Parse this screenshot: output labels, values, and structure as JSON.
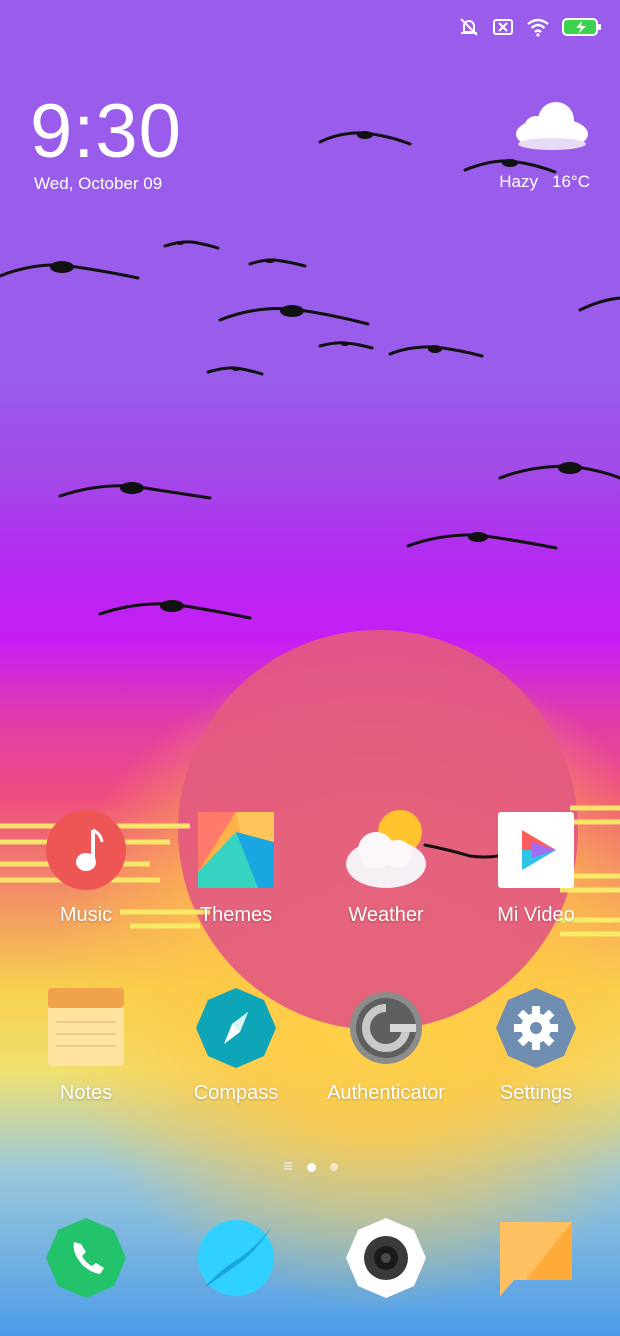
{
  "status_bar": {
    "icons": [
      "silent-off-icon",
      "sim-none-icon",
      "wifi-icon",
      "battery-charging-icon"
    ],
    "battery_color": "#3cd14f"
  },
  "lockscreen_widget": {
    "time": "9:30",
    "date": "Wed, October 09",
    "weather": {
      "condition": "Hazy",
      "temperature": "16°C"
    }
  },
  "apps_row1": [
    {
      "label": "Music",
      "icon": "music-note-icon"
    },
    {
      "label": "Themes",
      "icon": "themes-icon"
    },
    {
      "label": "Weather",
      "icon": "weather-icon"
    },
    {
      "label": "Mi Video",
      "icon": "play-icon"
    }
  ],
  "apps_row2": [
    {
      "label": "Notes",
      "icon": "notes-icon"
    },
    {
      "label": "Compass",
      "icon": "compass-icon"
    },
    {
      "label": "Authenticator",
      "icon": "authenticator-icon"
    },
    {
      "label": "Settings",
      "icon": "gear-icon"
    }
  ],
  "page_indicator": {
    "pages": 2,
    "active": 0
  },
  "dock": [
    {
      "icon": "phone-icon"
    },
    {
      "icon": "browser-icon"
    },
    {
      "icon": "camera-icon"
    },
    {
      "icon": "messages-icon"
    }
  ],
  "colors": {
    "music": "#ee5555",
    "phone": "#22c36a",
    "browser": "#30d1ff",
    "compass": "#0fa5b8",
    "settings": "#6f8eb2",
    "messages": "#ffc062"
  }
}
